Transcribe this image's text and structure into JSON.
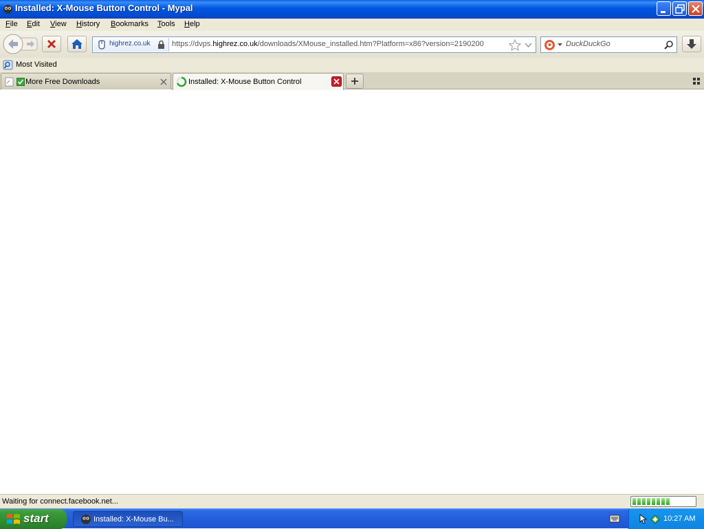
{
  "window": {
    "title": "Installed: X-Mouse Button Control - Mypal"
  },
  "menu": {
    "items": [
      "File",
      "Edit",
      "View",
      "History",
      "Bookmarks",
      "Tools",
      "Help"
    ]
  },
  "navigation": {
    "identity_host": "highrez.co.uk",
    "url_prefix": "https://dvps.",
    "url_domain": "highrez.co.uk",
    "url_path": "/downloads/XMouse_installed.htm?Platform=x86?version=2190200",
    "search_placeholder": "DuckDuckGo"
  },
  "bookmarks": {
    "most_visited": "Most Visited"
  },
  "tabs": [
    {
      "label": "More Free Downloads",
      "active": false
    },
    {
      "label": "Installed: X-Mouse Button Control",
      "active": true
    }
  ],
  "status": {
    "text": "Waiting for connect.facebook.net...",
    "progress_fraction": 0.62
  },
  "taskbar": {
    "start_label": "start",
    "task_label": "Installed: X-Mouse Bu...",
    "clock": "10:27 AM"
  },
  "colors": {
    "titlebar": "#0058e2",
    "taskbar": "#245edb",
    "start_button": "#3d9b3d",
    "chrome": "#ece9d8"
  }
}
